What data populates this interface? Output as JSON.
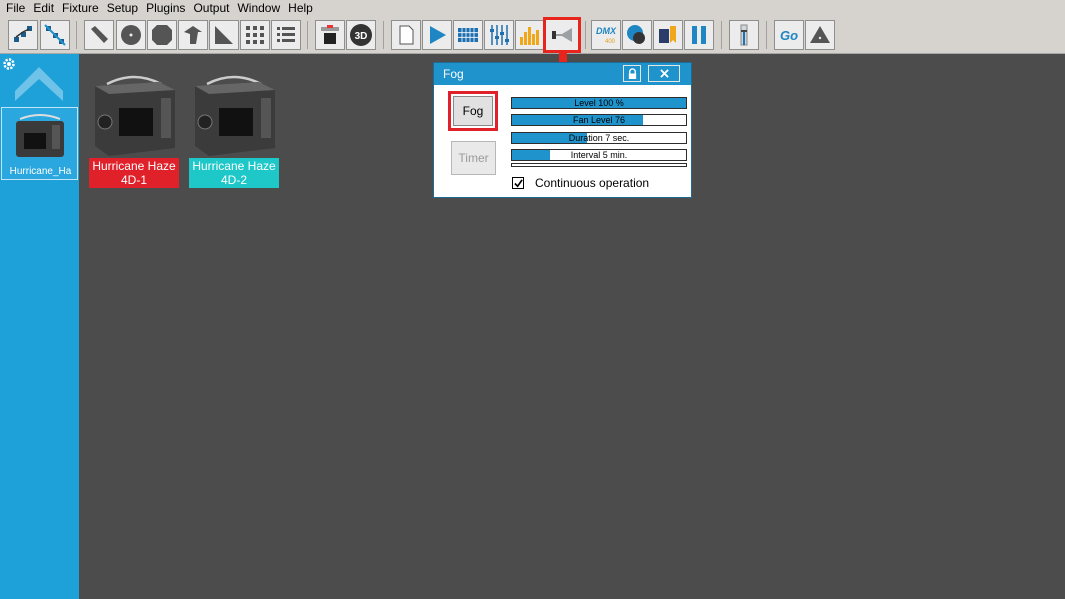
{
  "menu": [
    "File",
    "Edit",
    "Fixture",
    "Setup",
    "Plugins",
    "Output",
    "Window",
    "Help"
  ],
  "toolbar": {
    "icons": [
      "fixture-group-icon",
      "fixture-link-icon",
      "beam-icon",
      "gobo-circle-icon",
      "gobo-round-icon",
      "moving-head-icon",
      "angle-icon",
      "grid-icon",
      "list-icon",
      "screen-icon",
      "3d-icon",
      "new-page-icon",
      "play-icon",
      "matrix-icon",
      "faders-icon",
      "equalizer-icon",
      "fog-icon",
      "dmx-icon",
      "color-mix-icon",
      "lights-icon",
      "pause-icon",
      "master-icon",
      "go-icon",
      "warning-icon"
    ],
    "threed_label": "3D",
    "dmx_label": "DMX",
    "dmx_sub": "400",
    "go_label": "Go",
    "highlighted": "fog-icon",
    "highlight_color": "#e8251d"
  },
  "left_panel": {
    "thumb_label": "Hurricane_Ha",
    "color": "#1ea0d8"
  },
  "fixtures": [
    {
      "name_line1": "Hurricane Haze",
      "name_line2": "4D-1",
      "color": "#e0212a"
    },
    {
      "name_line1": "Hurricane Haze",
      "name_line2": "4D-2",
      "color": "#1ec8c8"
    }
  ],
  "fog_dialog": {
    "title": "Fog",
    "fog_button": "Fog",
    "timer_button": "Timer",
    "sliders": [
      {
        "label": "Level 100 %",
        "fill": 1.0
      },
      {
        "label": "Fan Level 76",
        "fill": 0.75
      },
      {
        "label": "Duration 7 sec.",
        "fill": 0.43
      },
      {
        "label": "Interval 5 min.",
        "fill": 0.22
      }
    ],
    "continuous_label": "Continuous operation",
    "continuous_checked": true
  }
}
